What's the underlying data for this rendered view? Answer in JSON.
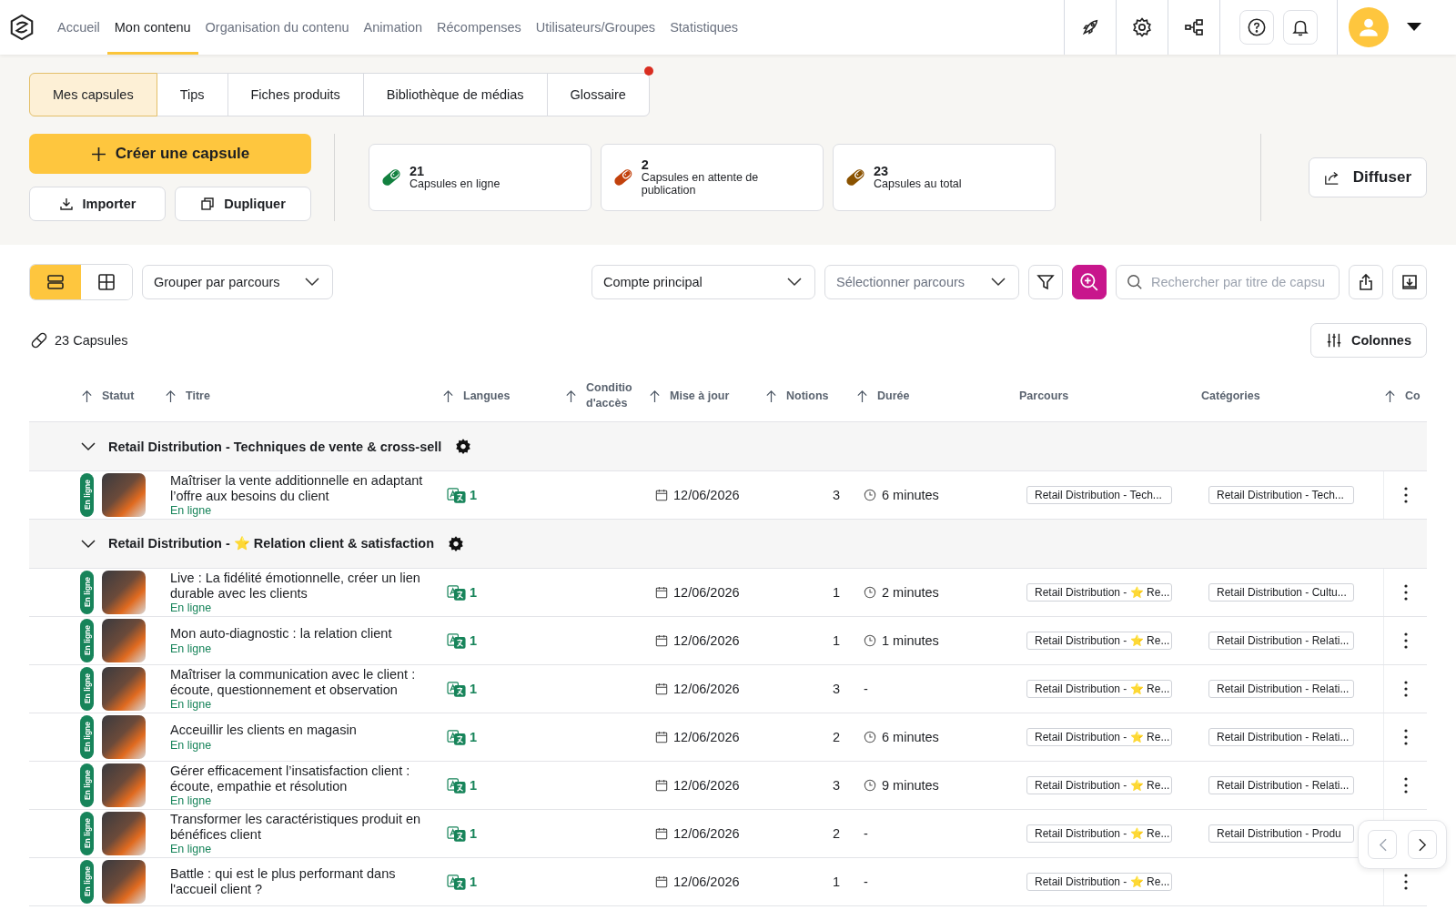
{
  "nav": {
    "items": [
      {
        "label": "Accueil",
        "selected": false
      },
      {
        "label": "Mon contenu",
        "selected": true
      },
      {
        "label": "Organisation du contenu",
        "selected": false
      },
      {
        "label": "Animation",
        "selected": false
      },
      {
        "label": "Récompenses",
        "selected": false
      },
      {
        "label": "Utilisateurs/Groupes",
        "selected": false
      },
      {
        "label": "Statistiques",
        "selected": false
      }
    ]
  },
  "tabs": [
    {
      "label": "Mes capsules",
      "selected": true,
      "dot": false
    },
    {
      "label": "Tips",
      "selected": false,
      "dot": false
    },
    {
      "label": "Fiches produits",
      "selected": false,
      "dot": false
    },
    {
      "label": "Bibliothèque de médias",
      "selected": false,
      "dot": false
    },
    {
      "label": "Glossaire",
      "selected": false,
      "dot": true
    }
  ],
  "actions": {
    "create": "Créer une capsule",
    "import": "Importer",
    "duplicate": "Dupliquer",
    "share": "Diffuser"
  },
  "stats": [
    {
      "value": "21",
      "label": "Capsules en ligne",
      "color": "#12803f"
    },
    {
      "value": "2",
      "label": "Capsules en attente de publication",
      "color": "#c2410c"
    },
    {
      "value": "23",
      "label": "Capsules au total",
      "color": "#8a5200"
    }
  ],
  "toolbar": {
    "views": [
      {
        "kind": "list",
        "selected": true
      },
      {
        "kind": "grid",
        "selected": false
      }
    ],
    "group_by": "Grouper par parcours",
    "account": "Compte principal",
    "parcours": {
      "placeholder": "Sélectionner parcours"
    },
    "search": {
      "placeholder": "Rechercher par titre de capsu"
    }
  },
  "count": "23 Capsules",
  "columns_button": "Colonnes",
  "table": {
    "columns": [
      {
        "label": "Statut",
        "sortable": true
      },
      {
        "label": "Titre",
        "sortable": true
      },
      {
        "label": "Langues",
        "sortable": true
      },
      {
        "label": "Conditio d'accès",
        "sortable": true
      },
      {
        "label": "Mise à jour",
        "sortable": true
      },
      {
        "label": "Notions",
        "sortable": true
      },
      {
        "label": "Durée",
        "sortable": true
      },
      {
        "label": "Parcours",
        "sortable": false
      },
      {
        "label": "Catégories",
        "sortable": false
      },
      {
        "label": "Co",
        "sortable": true
      }
    ],
    "groups": [
      {
        "title": "Retail Distribution - Techniques de vente & cross-sell",
        "expanded": true,
        "rows": [
          {
            "badge": "En ligne",
            "title": "Maîtriser la vente additionnelle en adaptant l’offre aux besoins du client",
            "status_text": "En ligne",
            "languages": "1",
            "date": "12/06/2026",
            "notions": "3",
            "timed": true,
            "duration": "6 minutes",
            "parcours": "Retail Distribution - Tech...",
            "category": "Retail Distribution - Tech..."
          }
        ]
      },
      {
        "title": "Retail Distribution - ⭐ Relation client & satisfaction",
        "expanded": true,
        "rows": [
          {
            "badge": "En ligne",
            "title": "Live : La fidélité émotionnelle, créer un lien durable avec les clients",
            "status_text": "En ligne",
            "languages": "1",
            "date": "12/06/2026",
            "notions": "1",
            "timed": true,
            "duration": "2 minutes",
            "parcours": "Retail Distribution - ⭐ Re...",
            "category": "Retail Distribution - Cultu..."
          },
          {
            "badge": "En ligne",
            "title": "Mon auto-diagnostic : la relation client",
            "status_text": "En ligne",
            "languages": "1",
            "date": "12/06/2026",
            "notions": "1",
            "timed": true,
            "duration": "1 minutes",
            "parcours": "Retail Distribution - ⭐ Re...",
            "category": "Retail Distribution - Relati..."
          },
          {
            "badge": "En ligne",
            "title": "Maîtriser la communication avec le client : écoute, questionnement et observation",
            "status_text": "En ligne",
            "languages": "1",
            "date": "12/06/2026",
            "notions": "3",
            "timed": false,
            "duration": "-",
            "parcours": "Retail Distribution - ⭐ Re...",
            "category": "Retail Distribution - Relati..."
          },
          {
            "badge": "En ligne",
            "title": "Acceuillir les clients en magasin",
            "status_text": "En ligne",
            "languages": "1",
            "date": "12/06/2026",
            "notions": "2",
            "timed": true,
            "duration": "6 minutes",
            "parcours": "Retail Distribution - ⭐ Re...",
            "category": "Retail Distribution - Relati..."
          },
          {
            "badge": "En ligne",
            "title": "Gérer efficacement l’insatisfaction client : écoute, empathie et résolution",
            "status_text": "En ligne",
            "languages": "1",
            "date": "12/06/2026",
            "notions": "3",
            "timed": true,
            "duration": "9 minutes",
            "parcours": "Retail Distribution - ⭐ Re...",
            "category": "Retail Distribution - Relati..."
          },
          {
            "badge": "En ligne",
            "title": "Transformer les caractéristiques produit en bénéfices client",
            "status_text": "En ligne",
            "languages": "1",
            "date": "12/06/2026",
            "notions": "2",
            "timed": false,
            "duration": "-",
            "parcours": "Retail Distribution - ⭐ Re...",
            "category": "Retail Distribution - Produ"
          },
          {
            "badge": "En ligne",
            "title": "Battle : qui est le plus performant dans l'accueil client ?",
            "languages": "1",
            "date": "12/06/2026",
            "notions": "1",
            "timed": false,
            "duration": "-",
            "parcours": "Retail Distribution - ⭐ Re..."
          }
        ]
      }
    ]
  }
}
